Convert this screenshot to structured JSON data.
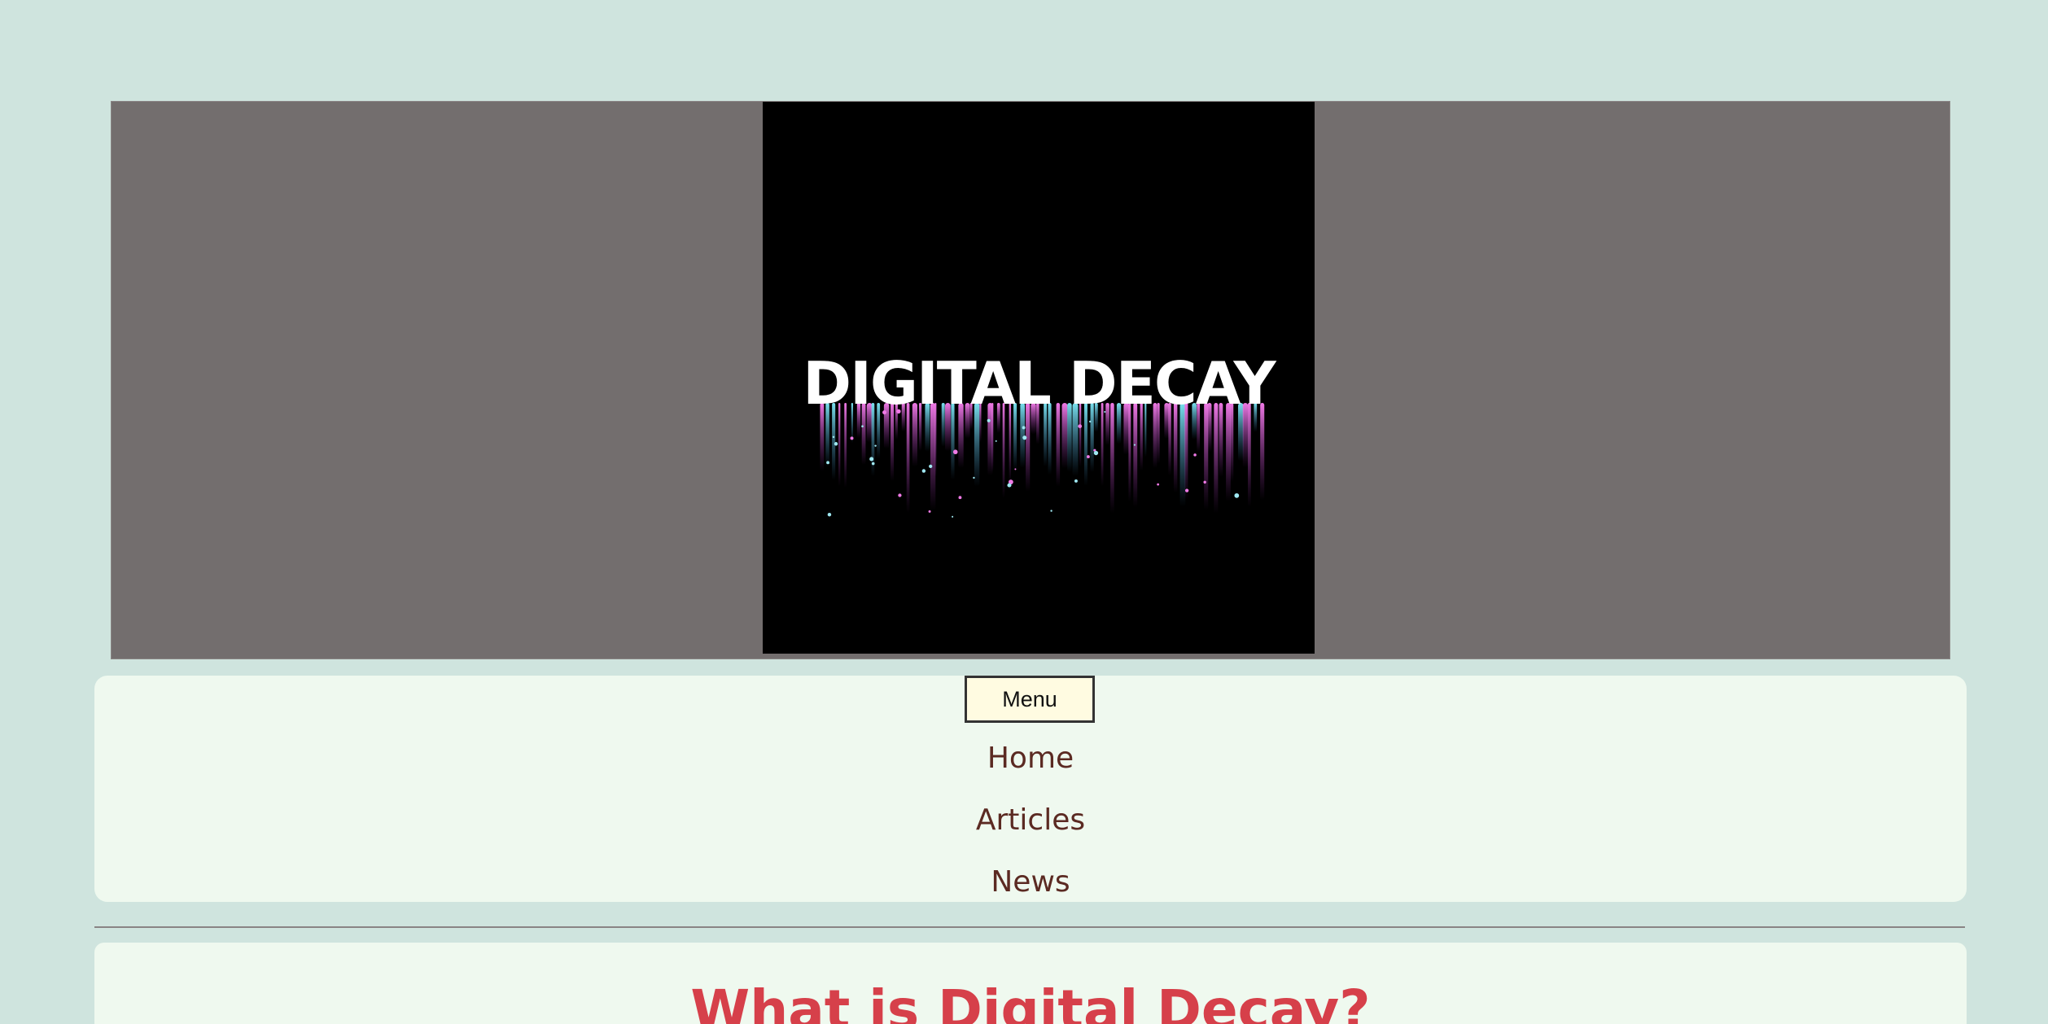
{
  "banner": {
    "logo_text": "DIGITAL DECAY"
  },
  "nav": {
    "menu_label": "Menu",
    "items": [
      {
        "label": "Home"
      },
      {
        "label": "Articles"
      },
      {
        "label": "News"
      }
    ]
  },
  "content": {
    "title": "What is Digital Decay?"
  },
  "colors": {
    "background": "#cfe4de",
    "banner_bg": "#736e6e",
    "card_bg": "#eff9ef",
    "nav_link": "#5b2a22",
    "menu_button_bg": "#fffbe1",
    "title_color": "#d6404a",
    "drip_pink": "#e46ee0",
    "drip_cyan": "#6ad6e6"
  },
  "icons": {
    "logo": "digital-decay-logo"
  }
}
